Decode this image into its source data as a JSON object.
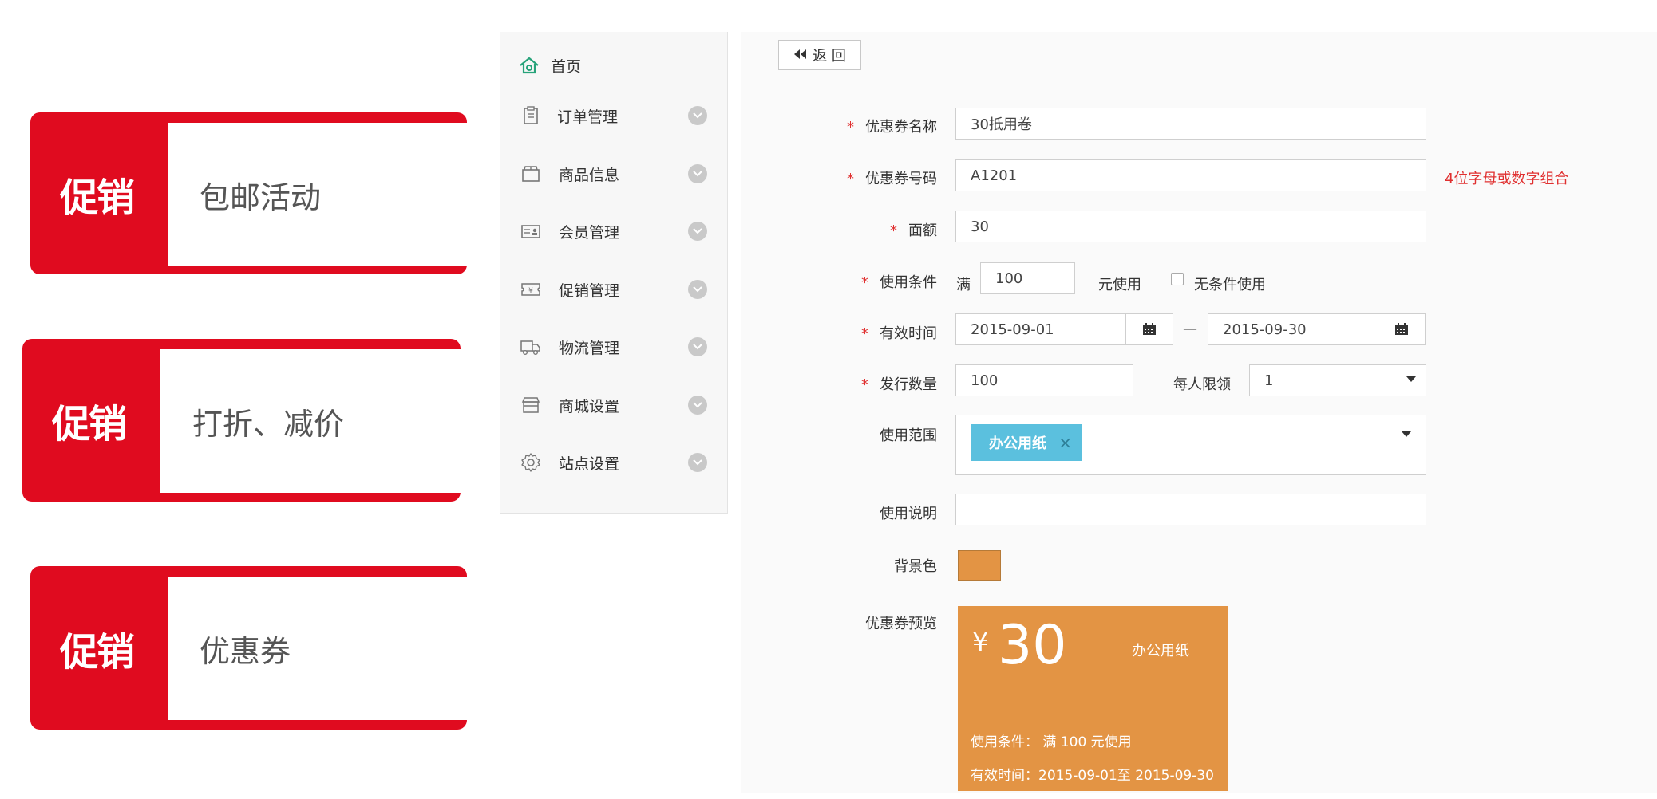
{
  "promo_cards": [
    {
      "tag": "促销",
      "title": "包邮活动"
    },
    {
      "tag": "促销",
      "title": "打折、减价"
    },
    {
      "tag": "促销",
      "title": "优惠券"
    }
  ],
  "colors": {
    "promo_red": "#e00b1f",
    "chip_blue": "#5bc0de",
    "coupon_bg": "#e39444",
    "required_red": "#e03030",
    "home_icon_green": "#27a37a"
  },
  "sidebar": {
    "home": {
      "label": "首页",
      "icon": "home-icon"
    },
    "items": [
      {
        "label": "订单管理",
        "icon": "clipboard-icon"
      },
      {
        "label": "商品信息",
        "icon": "box-icon"
      },
      {
        "label": "会员管理",
        "icon": "member-card-icon"
      },
      {
        "label": "促销管理",
        "icon": "ticket-icon"
      },
      {
        "label": "物流管理",
        "icon": "truck-icon"
      },
      {
        "label": "商城设置",
        "icon": "store-icon"
      },
      {
        "label": "站点设置",
        "icon": "gear-icon"
      }
    ]
  },
  "back_button": {
    "label": "返 回",
    "icon": "double-left-arrow-icon"
  },
  "required_mark": "*",
  "form": {
    "coupon_name": {
      "label": "优惠券名称",
      "value": "30抵用卷"
    },
    "coupon_code": {
      "label": "优惠券号码",
      "value": "A1201",
      "hint": "4位字母或数字组合"
    },
    "face_value": {
      "label": "面额",
      "value": "30"
    },
    "condition": {
      "label": "使用条件",
      "prefix": "满",
      "value": "100",
      "suffix": "元使用",
      "no_condition_label": "无条件使用",
      "no_condition_checked": false
    },
    "validity": {
      "label": "有效时间",
      "start": "2015-09-01",
      "separator": "—",
      "end": "2015-09-30"
    },
    "quantity": {
      "label": "发行数量",
      "value": "100",
      "per_person_label": "每人限领",
      "per_person_value": "1"
    },
    "scope": {
      "label": "使用范围",
      "tags": [
        "办公用纸"
      ],
      "remove_glyph": "×"
    },
    "description": {
      "label": "使用说明",
      "value": ""
    },
    "bg_color": {
      "label": "背景色",
      "value": "#e39444"
    },
    "preview_label": "优惠券预览"
  },
  "preview": {
    "currency": "¥",
    "amount": "30",
    "scope": "办公用纸",
    "condition_text": "使用条件： 满 100 元使用",
    "validity_text": "有效时间：2015-09-01至 2015-09-30"
  }
}
